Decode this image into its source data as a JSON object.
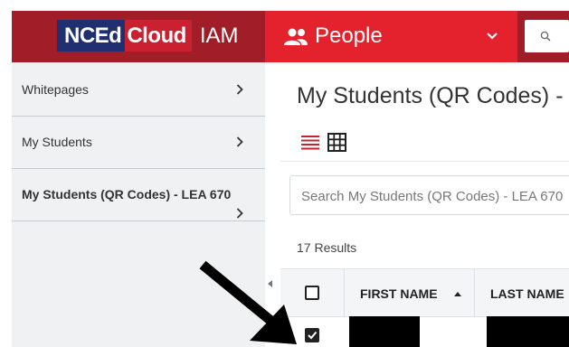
{
  "header": {
    "logo": {
      "part1": "NCEd",
      "part2": "Cloud",
      "suffix": "IAM"
    },
    "module_label": "People"
  },
  "sidebar": {
    "items": [
      {
        "label": "Whitepages"
      },
      {
        "label": "My Students"
      },
      {
        "label": "My Students (QR Codes) - LEA 670"
      }
    ]
  },
  "main": {
    "title": "My Students (QR Codes) -",
    "search_placeholder": "Search My Students (QR Codes) - LEA 670",
    "results_text": "17 Results",
    "table": {
      "columns": [
        "FIRST NAME",
        "LAST NAME"
      ]
    }
  },
  "colors": {
    "brand_dark": "#a11d27",
    "brand_red": "#e3222d",
    "logo_blue": "#1f2f6f",
    "sidebar_bg": "#eff1f2",
    "view_list_icon": "#c9212f"
  }
}
